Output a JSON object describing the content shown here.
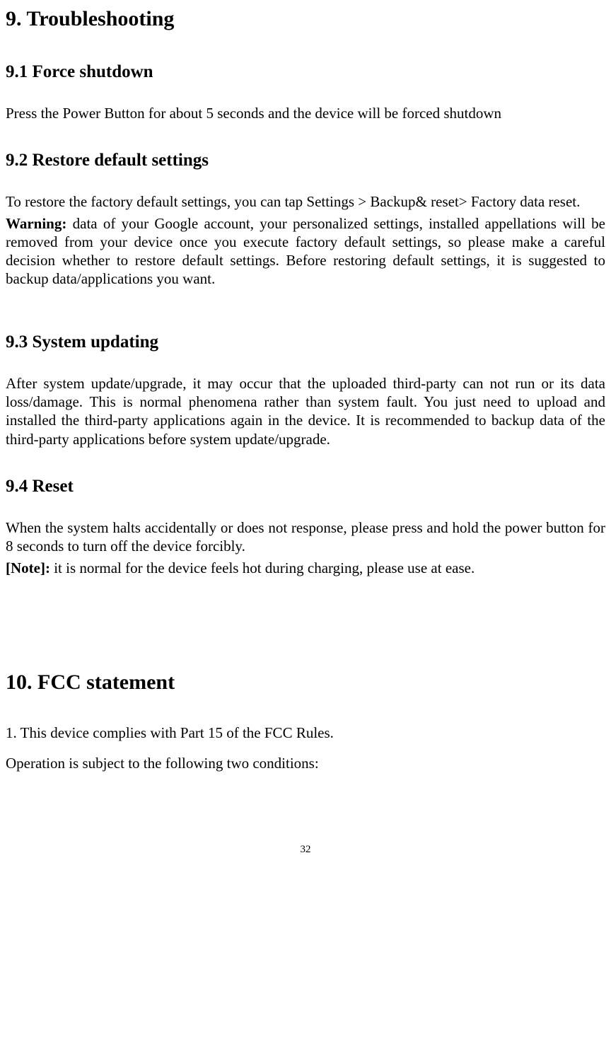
{
  "h1": "9. Troubleshooting",
  "s91": {
    "heading": "9.1 Force shutdown",
    "p1": "Press the Power Button for about 5 seconds and the device will be forced shutdown"
  },
  "s92": {
    "heading": "9.2 Restore default settings",
    "p1": "To restore the factory default settings, you can tap Settings > Backup& reset> Factory data reset.",
    "warn_label": "Warning:",
    "warn_text": " data of your Google account, your personalized settings, installed appellations will be removed from your device once you execute factory default settings, so please make a careful decision whether to restore default settings. Before restoring default settings, it is suggested to backup data/applications you want."
  },
  "s93": {
    "heading": "9.3 System updating",
    "p1": "After system update/upgrade, it may occur that the uploaded third-party can not run or its data loss/damage. This is normal phenomena rather than system fault. You just need to upload and installed the third-party applications again in the device. It is recommended to backup data of the third-party applications before system update/upgrade."
  },
  "s94": {
    "heading": "9.4 Reset",
    "p1": "When the system halts accidentally or does not response, please press and hold the power button for 8 seconds to turn off the device forcibly.",
    "note_label": "[Note]:",
    "note_text": " it is normal for the device feels hot during charging, please use at ease."
  },
  "h10": "10. FCC statement",
  "fcc": {
    "p1": "1. This device complies with Part 15 of the FCC Rules.",
    "p2": "Operation is subject to the following two conditions:"
  },
  "page_number": "32"
}
